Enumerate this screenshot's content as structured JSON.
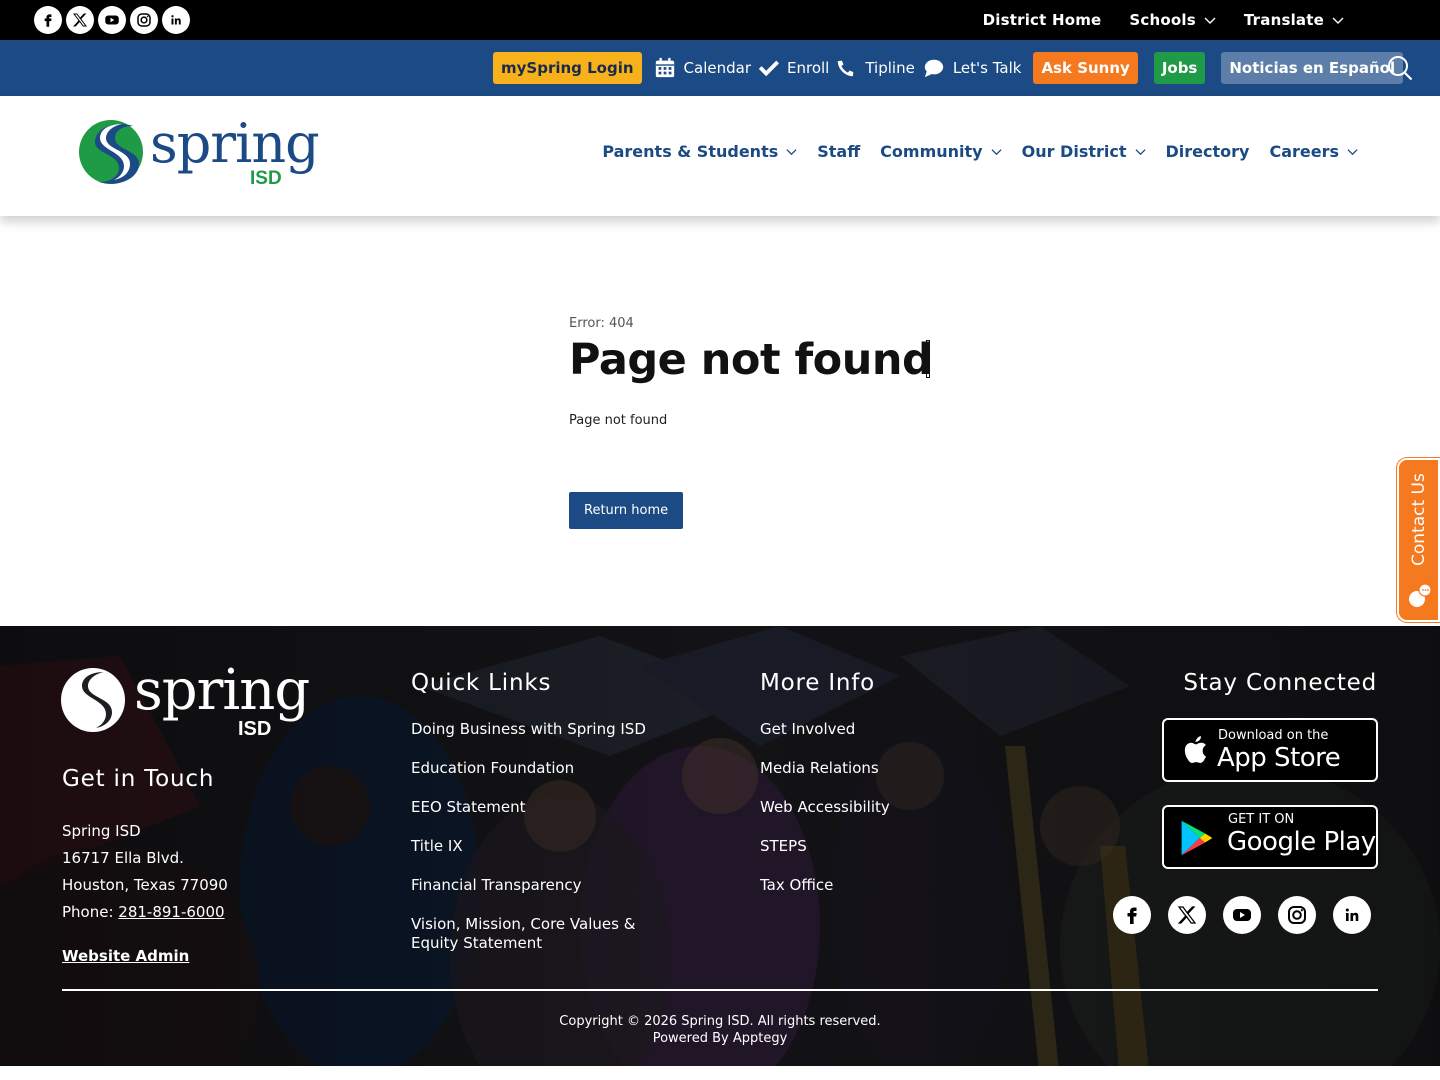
{
  "topbar": {
    "social_icons": [
      "facebook-icon",
      "x-icon",
      "youtube-icon",
      "instagram-icon",
      "linkedin-icon"
    ],
    "links": {
      "district_home": "District Home",
      "schools": "Schools",
      "translate": "Translate"
    }
  },
  "utility": {
    "myspring_login": "mySpring Login",
    "calendar": "Calendar",
    "enroll": "Enroll",
    "tipline": "Tipline",
    "lets_talk": "Let's Talk",
    "ask_sunny": "Ask Sunny",
    "jobs": "Jobs",
    "noticias": "Noticias en Español"
  },
  "header": {
    "logo_word": "spring",
    "logo_sub": "ISD",
    "nav": {
      "parents_students": "Parents & Students",
      "staff": "Staff",
      "community": "Community",
      "our_district": "Our District",
      "directory": "Directory",
      "careers": "Careers"
    }
  },
  "content": {
    "error_code": "Error: 404",
    "title": "Page not found",
    "message": "Page not found",
    "return_button": "Return home"
  },
  "contact_tab": {
    "label": "Contact Us"
  },
  "footer": {
    "get_in_touch": "Get in Touch",
    "address": {
      "name": "Spring ISD",
      "street": "16717 Ella Blvd.",
      "city": "Houston, Texas 77090",
      "phone_label": "Phone: ",
      "phone": "281-891-6000"
    },
    "website_admin": "Website Admin",
    "quick_links_heading": "Quick Links",
    "quick_links": [
      "Doing Business with Spring ISD",
      "Education Foundation",
      "EEO Statement",
      "Title IX",
      "Financial Transparency",
      "Vision, Mission, Core Values & Equity Statement"
    ],
    "more_info_heading": "More Info",
    "more_info": [
      "Get Involved",
      "Media Relations",
      "Web Accessibility",
      "STEPS",
      "Tax Office"
    ],
    "stay_connected_heading": "Stay Connected",
    "app_store": {
      "small": "Download on the",
      "big": "App Store"
    },
    "google_play": {
      "small": "GET IT ON",
      "big": "Google Play"
    },
    "copyright": "Copyright © 2026 Spring ISD. All rights reserved.",
    "powered_by": "Powered By Apptegy"
  },
  "colors": {
    "brand_blue": "#1b4a84",
    "brand_green": "#1f9a47",
    "login_yellow": "#f7b21b",
    "sunny_orange": "#f4791f",
    "noticias_blue": "#5c7ea8"
  }
}
